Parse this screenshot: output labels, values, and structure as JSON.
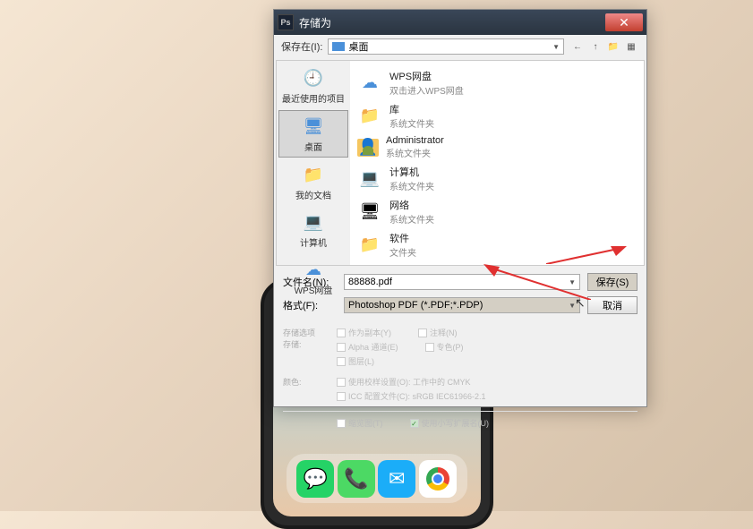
{
  "dialog": {
    "title": "存储为",
    "app_badge": "Ps",
    "location_label": "保存在(I):",
    "location_value": "桌面"
  },
  "sidebar": {
    "items": [
      {
        "label": "最近使用的项目",
        "icon": "recent"
      },
      {
        "label": "桌面",
        "icon": "desktop",
        "selected": true
      },
      {
        "label": "我的文档",
        "icon": "docs"
      },
      {
        "label": "计算机",
        "icon": "computer"
      },
      {
        "label": "WPS网盘",
        "icon": "cloud"
      }
    ]
  },
  "files": [
    {
      "name": "WPS网盘",
      "sub": "双击进入WPS网盘",
      "icon": "cloud"
    },
    {
      "name": "库",
      "sub": "系统文件夹",
      "icon": "folder"
    },
    {
      "name": "Administrator",
      "sub": "系统文件夹",
      "icon": "admin"
    },
    {
      "name": "计算机",
      "sub": "系统文件夹",
      "icon": "computer"
    },
    {
      "name": "网络",
      "sub": "系统文件夹",
      "icon": "network"
    },
    {
      "name": "软件",
      "sub": "文件夹",
      "icon": "folder"
    }
  ],
  "fields": {
    "filename_label": "文件名(N):",
    "filename_value": "88888.pdf",
    "format_label": "格式(F):",
    "format_value": "Photoshop PDF (*.PDF;*.PDP)",
    "save_btn": "保存(S)",
    "cancel_btn": "取消"
  },
  "options": {
    "section1_label": "存储选项",
    "section1_sublabel": "存储:",
    "checks1": [
      {
        "label": "作为副本(Y)",
        "checked": false
      },
      {
        "label": "注释(N)",
        "checked": false
      },
      {
        "label": "Alpha 通道(E)",
        "checked": false
      },
      {
        "label": "专色(P)",
        "checked": false
      },
      {
        "label": "图层(L)",
        "checked": false
      }
    ],
    "section2_label": "颜色:",
    "checks2": [
      {
        "label": "使用校样设置(O): 工作中的 CMYK",
        "checked": false
      },
      {
        "label": "ICC 配置文件(C): sRGB IEC61966-2.1",
        "checked": false
      }
    ],
    "bottom_checks": [
      {
        "label": "缩览图(T)",
        "checked": false
      },
      {
        "label": "使用小写扩展名(U)",
        "checked": true
      }
    ]
  }
}
